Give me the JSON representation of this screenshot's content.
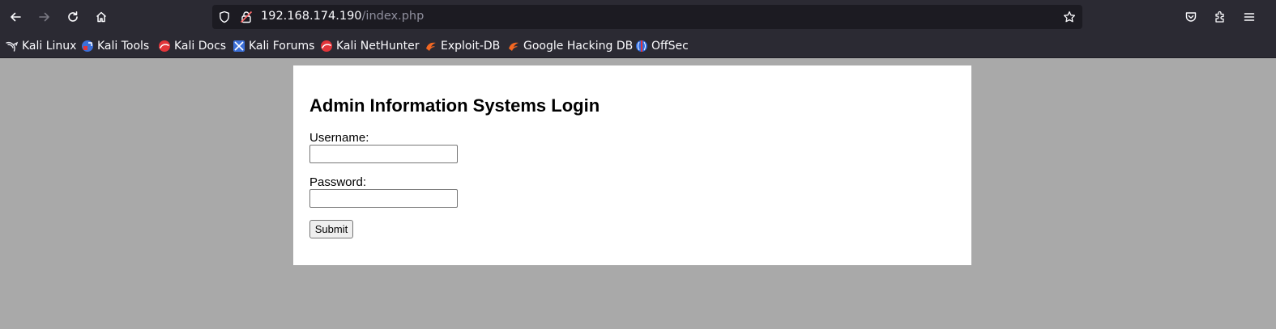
{
  "browser": {
    "url_host": "192.168.174.190",
    "url_path": "/index.php",
    "nav_icons": [
      "back-icon",
      "forward-icon",
      "reload-icon",
      "home-icon"
    ],
    "url_icons": [
      "shield-icon",
      "insecure-lock-icon",
      "star-bookmark-icon"
    ],
    "toolbar_icons": [
      "pocket-icon",
      "extensions-icon",
      "menu-icon"
    ]
  },
  "bookmarks": [
    {
      "label": "Kali Linux",
      "icon": "kali-dragon-icon"
    },
    {
      "label": "Kali Tools",
      "icon": "kali-tools-icon"
    },
    {
      "label": "Kali Docs",
      "icon": "kali-docs-icon"
    },
    {
      "label": "Kali Forums",
      "icon": "kali-forums-icon"
    },
    {
      "label": "Kali NetHunter",
      "icon": "kali-nethunter-icon"
    },
    {
      "label": "Exploit-DB",
      "icon": "exploit-db-icon"
    },
    {
      "label": "Google Hacking DB",
      "icon": "ghdb-icon"
    },
    {
      "label": "OffSec",
      "icon": "offsec-icon"
    }
  ],
  "page": {
    "heading": "Admin Information Systems Login",
    "username_label": "Username:",
    "username_value": "",
    "password_label": "Password:",
    "password_value": "",
    "submit_label": "Submit"
  },
  "colors": {
    "toolbar_bg": "#2b2a33",
    "url_bar_bg": "#1c1b22",
    "page_bg": "#a9a9a9",
    "card_bg": "#ffffff"
  }
}
